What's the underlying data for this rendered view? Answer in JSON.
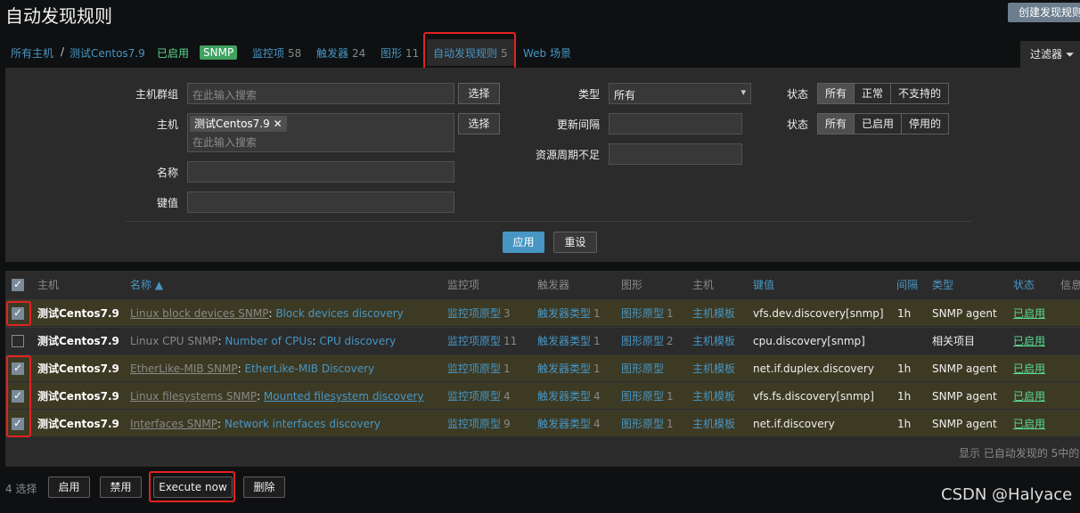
{
  "header": {
    "title": "自动发现规则",
    "create_button": "创建发现规则"
  },
  "nav": {
    "all_hosts": "所有主机",
    "separator": "/",
    "host": "测试Centos7.9",
    "enabled": "已启用",
    "snmp": "SNMP",
    "items_label": "监控项",
    "items_count": "58",
    "triggers_label": "触发器",
    "triggers_count": "24",
    "graphs_label": "图形",
    "graphs_count": "11",
    "discovery_label": "自动发现规则",
    "discovery_count": "5",
    "web_label": "Web 场景",
    "filter_tab": "过滤器"
  },
  "filter": {
    "host_groups_label": "主机群组",
    "host_groups_placeholder": "在此输入搜索",
    "select_button": "选择",
    "host_label": "主机",
    "host_tag": "测试Centos7.9",
    "host_placeholder": "在此输入搜索",
    "name_label": "名称",
    "key_label": "键值",
    "type_label": "类型",
    "type_value": "所有",
    "update_interval_label": "更新间隔",
    "keep_lost_label": "资源周期不足",
    "state_label": "状态",
    "state_options": [
      "所有",
      "正常",
      "不支持的"
    ],
    "status_label": "状态",
    "status_options": [
      "所有",
      "已启用",
      "停用的"
    ],
    "apply": "应用",
    "reset": "重设"
  },
  "table": {
    "columns": {
      "host": "主机",
      "name": "名称 ▲",
      "items": "监控项",
      "triggers": "触发器",
      "graphs": "图形",
      "hosts": "主机",
      "key": "键值",
      "interval": "间隔",
      "type": "类型",
      "status": "状态",
      "info": "信息"
    },
    "rows": [
      {
        "checked": true,
        "host": "测试Centos7.9",
        "template": "Linux block devices SNMP",
        "name": "Block devices discovery",
        "items_label": "监控项原型",
        "items_count": "3",
        "triggers_label": "触发器类型",
        "triggers_count": "1",
        "graphs_label": "图形原型",
        "graphs_count": "1",
        "hosts_label": "主机模板",
        "key": "vfs.dev.discovery[snmp]",
        "interval": "1h",
        "type": "SNMP agent",
        "status": "已启用"
      },
      {
        "checked": false,
        "host": "测试Centos7.9",
        "template": "Linux CPU SNMP",
        "name": "Number of CPUs",
        "name2": "CPU discovery",
        "items_label": "监控项原型",
        "items_count": "11",
        "triggers_label": "触发器类型",
        "triggers_count": "1",
        "graphs_label": "图形原型",
        "graphs_count": "2",
        "hosts_label": "主机模板",
        "key": "cpu.discovery[snmp]",
        "interval": "",
        "type": "相关项目",
        "status": "已启用"
      },
      {
        "checked": true,
        "host": "测试Centos7.9",
        "template": "EtherLike-MIB SNMP",
        "name": "EtherLike-MIB Discovery",
        "items_label": "监控项原型",
        "items_count": "1",
        "triggers_label": "触发器类型",
        "triggers_count": "1",
        "graphs_label": "图形原型",
        "graphs_count": "",
        "hosts_label": "主机模板",
        "key": "net.if.duplex.discovery",
        "interval": "1h",
        "type": "SNMP agent",
        "status": "已启用"
      },
      {
        "checked": true,
        "host": "测试Centos7.9",
        "template": "Linux filesystems SNMP",
        "name": "Mounted filesystem discovery",
        "items_label": "监控项原型",
        "items_count": "4",
        "triggers_label": "触发器类型",
        "triggers_count": "4",
        "graphs_label": "图形原型",
        "graphs_count": "1",
        "hosts_label": "主机模板",
        "key": "vfs.fs.discovery[snmp]",
        "interval": "1h",
        "type": "SNMP agent",
        "status": "已启用"
      },
      {
        "checked": true,
        "host": "测试Centos7.9",
        "template": "Interfaces SNMP",
        "name": "Network interfaces discovery",
        "items_label": "监控项原型",
        "items_count": "9",
        "triggers_label": "触发器类型",
        "triggers_count": "4",
        "graphs_label": "图形原型",
        "graphs_count": "1",
        "hosts_label": "主机模板",
        "key": "net.if.discovery",
        "interval": "1h",
        "type": "SNMP agent",
        "status": "已启用"
      }
    ],
    "footer": "显示 已自动发现的 5中的5"
  },
  "actions": {
    "selected": "4 选择",
    "enable": "启用",
    "disable": "禁用",
    "execute_now": "Execute now",
    "delete": "删除"
  },
  "watermark": "CSDN @Halyace"
}
